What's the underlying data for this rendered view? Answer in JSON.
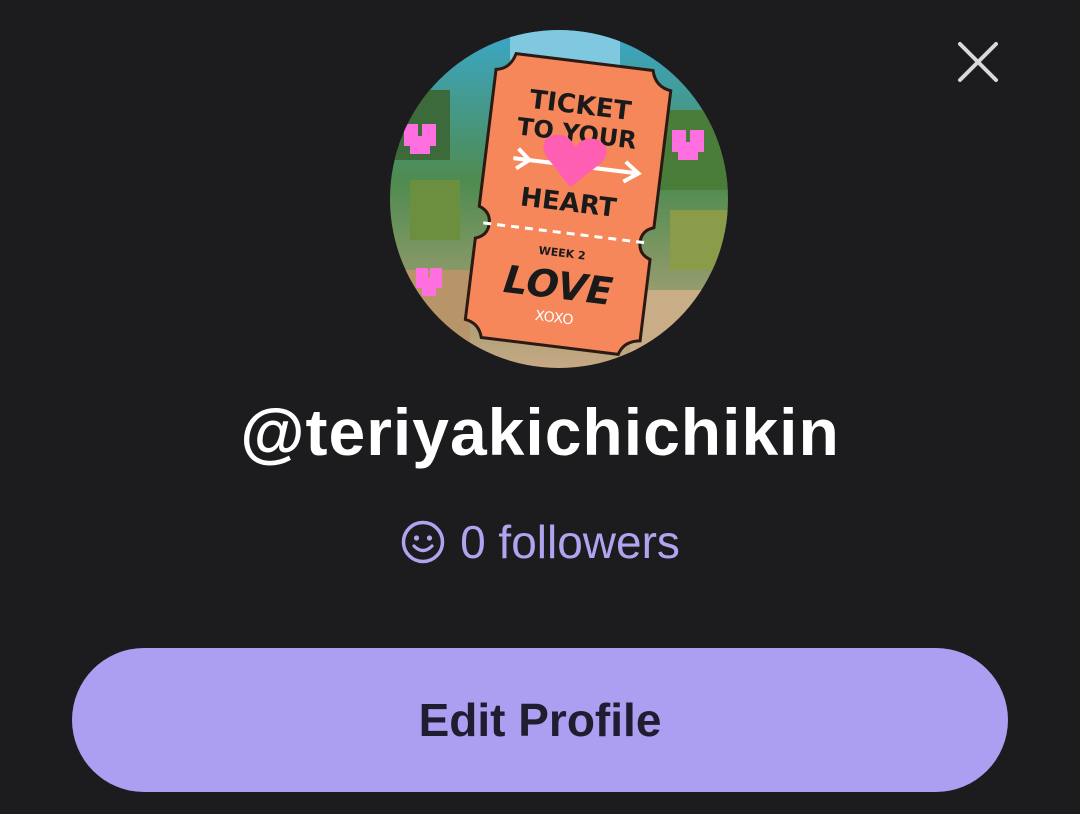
{
  "profile": {
    "username": "@teriyakichichikin",
    "followers_text": "0 followers",
    "avatar_text": {
      "line1": "TICKET",
      "line2": "TO YOUR",
      "line3": "HEART",
      "week": "WEEK 2",
      "love": "LOVE",
      "xo": "XOXO"
    }
  },
  "actions": {
    "edit_profile_label": "Edit Profile"
  },
  "icons": {
    "close": "close-icon",
    "followers": "smiley-face-icon"
  },
  "colors": {
    "background": "#1c1b1d",
    "accent": "#ac9ef0",
    "followers_text": "#b1a3ef",
    "button_text": "#221c30",
    "ticket": "#f5875a"
  }
}
